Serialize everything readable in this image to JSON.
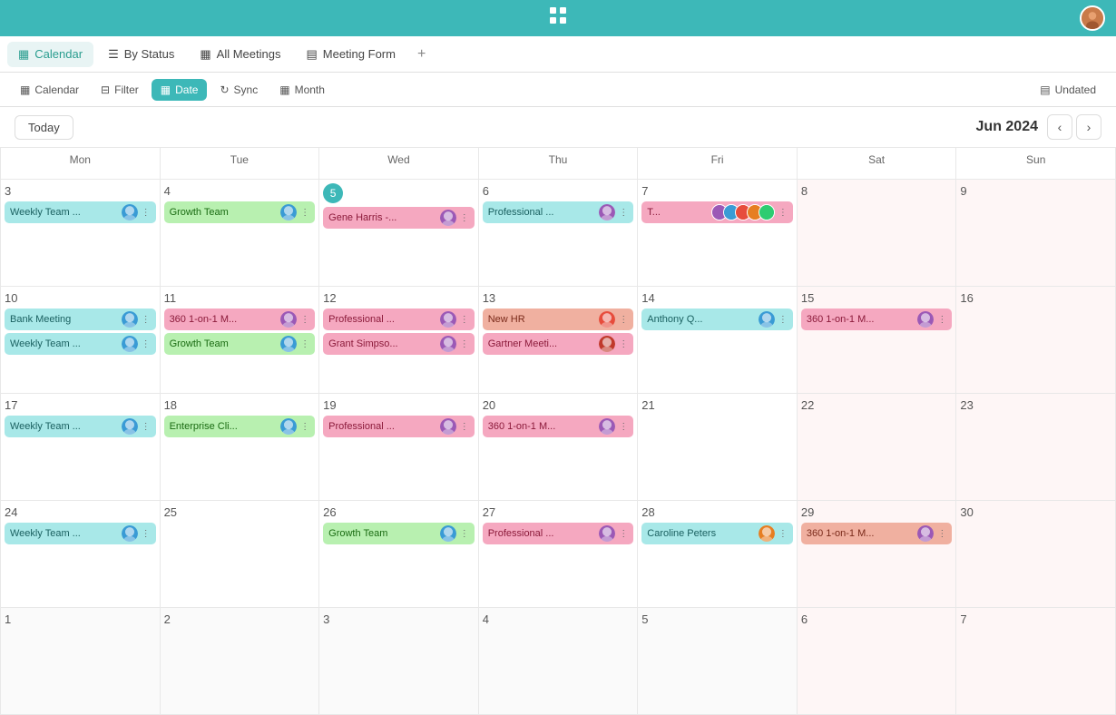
{
  "appBar": {
    "logo": "⠿",
    "logoText": "⌗"
  },
  "tabs": [
    {
      "id": "calendar",
      "label": "Calendar",
      "icon": "▦",
      "active": true
    },
    {
      "id": "by-status",
      "label": "By Status",
      "icon": "⚑"
    },
    {
      "id": "all-meetings",
      "label": "All Meetings",
      "icon": "▦"
    },
    {
      "id": "meeting-form",
      "label": "Meeting Form",
      "icon": "▤"
    }
  ],
  "toolbar": {
    "calendar": "Calendar",
    "filter": "Filter",
    "date": "Date",
    "sync": "Sync",
    "month": "Month",
    "undated": "Undated"
  },
  "navigation": {
    "today": "Today",
    "title": "Jun 2024"
  },
  "dayHeaders": [
    "Mon",
    "Tue",
    "Wed",
    "Thu",
    "Fri",
    "Sat",
    "Sun"
  ],
  "weeks": [
    {
      "days": [
        {
          "num": "3",
          "weekend": false,
          "events": [
            {
              "label": "Weekly Team ...",
              "color": "ev-teal",
              "avatar": "#3a9bd5"
            },
            {
              "label": "",
              "color": "",
              "avatar": ""
            }
          ]
        },
        {
          "num": "4",
          "weekend": false,
          "events": [
            {
              "label": "Growth Team",
              "color": "ev-green",
              "avatar": "#3a9bd5"
            }
          ]
        },
        {
          "num": "5",
          "today": true,
          "weekend": false,
          "events": [
            {
              "label": "Gene Harris -...",
              "color": "ev-pink",
              "avatar": "#9b59b6"
            }
          ]
        },
        {
          "num": "6",
          "weekend": false,
          "events": [
            {
              "label": "Professional ...",
              "color": "ev-teal",
              "avatar": "#9b59b6"
            }
          ]
        },
        {
          "num": "7",
          "weekend": false,
          "events": [
            {
              "label": "T...",
              "color": "ev-pink",
              "avatarStack": true
            }
          ]
        },
        {
          "num": "8",
          "weekend": true,
          "events": []
        },
        {
          "num": "9",
          "weekend": true,
          "events": []
        }
      ]
    },
    {
      "days": [
        {
          "num": "10",
          "weekend": false,
          "events": [
            {
              "label": "Bank Meeting",
              "color": "ev-teal",
              "avatar": "#3a9bd5"
            },
            {
              "label": "Weekly Team ...",
              "color": "ev-teal",
              "avatar": "#3a9bd5"
            }
          ]
        },
        {
          "num": "11",
          "weekend": false,
          "events": [
            {
              "label": "360 1-on-1 M...",
              "color": "ev-pink",
              "avatar": "#9b59b6"
            },
            {
              "label": "Growth Team",
              "color": "ev-green",
              "avatar": "#3a9bd5"
            }
          ]
        },
        {
          "num": "12",
          "weekend": false,
          "events": [
            {
              "label": "Professional ...",
              "color": "ev-pink",
              "avatar": "#9b59b6"
            },
            {
              "label": "Grant Simpso...",
              "color": "ev-pink",
              "avatar": "#9b59b6"
            }
          ]
        },
        {
          "num": "13",
          "weekend": false,
          "events": [
            {
              "label": "New HR",
              "color": "ev-salmon",
              "avatar": "#e74c3c"
            },
            {
              "label": "Gartner Meeti...",
              "color": "ev-pink",
              "avatar": "#c0392b"
            }
          ]
        },
        {
          "num": "14",
          "weekend": false,
          "events": [
            {
              "label": "Anthony Q...",
              "color": "ev-teal",
              "avatar": "#3a9bd5"
            },
            {
              "label": "",
              "color": "",
              "avatar": ""
            }
          ]
        },
        {
          "num": "15",
          "weekend": true,
          "events": [
            {
              "label": "360 1-on-1 M...",
              "color": "ev-pink",
              "avatar": "#9b59b6"
            }
          ]
        },
        {
          "num": "16",
          "weekend": true,
          "events": []
        }
      ]
    },
    {
      "days": [
        {
          "num": "17",
          "weekend": false,
          "events": [
            {
              "label": "Weekly Team ...",
              "color": "ev-teal",
              "avatar": "#3a9bd5"
            }
          ]
        },
        {
          "num": "18",
          "weekend": false,
          "events": [
            {
              "label": "Enterprise Cli...",
              "color": "ev-green",
              "avatar": "#3a9bd5"
            }
          ]
        },
        {
          "num": "19",
          "weekend": false,
          "events": [
            {
              "label": "Professional ...",
              "color": "ev-pink",
              "avatar": "#9b59b6"
            }
          ]
        },
        {
          "num": "20",
          "weekend": false,
          "events": [
            {
              "label": "360 1-on-1 M...",
              "color": "ev-pink",
              "avatar": "#9b59b6"
            }
          ]
        },
        {
          "num": "21",
          "weekend": false,
          "events": []
        },
        {
          "num": "22",
          "weekend": true,
          "events": []
        },
        {
          "num": "23",
          "weekend": true,
          "events": []
        }
      ]
    },
    {
      "days": [
        {
          "num": "24",
          "weekend": false,
          "events": [
            {
              "label": "Weekly Team ...",
              "color": "ev-teal",
              "avatar": "#3a9bd5"
            }
          ]
        },
        {
          "num": "25",
          "weekend": false,
          "events": []
        },
        {
          "num": "26",
          "weekend": false,
          "events": [
            {
              "label": "Growth Team",
              "color": "ev-green",
              "avatar": "#3a9bd5"
            }
          ]
        },
        {
          "num": "27",
          "weekend": false,
          "events": [
            {
              "label": "Professional ...",
              "color": "ev-pink",
              "avatar": "#9b59b6"
            }
          ]
        },
        {
          "num": "28",
          "weekend": false,
          "events": [
            {
              "label": "Caroline Peters",
              "color": "ev-teal",
              "avatar": "#e67e22"
            }
          ]
        },
        {
          "num": "29",
          "weekend": true,
          "events": [
            {
              "label": "360 1-on-1 M...",
              "color": "ev-salmon",
              "avatar": "#9b59b6"
            }
          ]
        },
        {
          "num": "30",
          "weekend": true,
          "events": []
        }
      ]
    },
    {
      "days": [
        {
          "num": "1",
          "weekend": false,
          "otherMonth": true,
          "events": []
        },
        {
          "num": "2",
          "weekend": false,
          "otherMonth": true,
          "events": []
        },
        {
          "num": "3",
          "weekend": false,
          "otherMonth": true,
          "events": []
        },
        {
          "num": "4",
          "weekend": false,
          "otherMonth": true,
          "events": []
        },
        {
          "num": "5",
          "weekend": false,
          "otherMonth": true,
          "events": []
        },
        {
          "num": "6",
          "weekend": true,
          "otherMonth": true,
          "events": []
        },
        {
          "num": "7",
          "weekend": true,
          "otherMonth": true,
          "events": []
        }
      ]
    }
  ]
}
